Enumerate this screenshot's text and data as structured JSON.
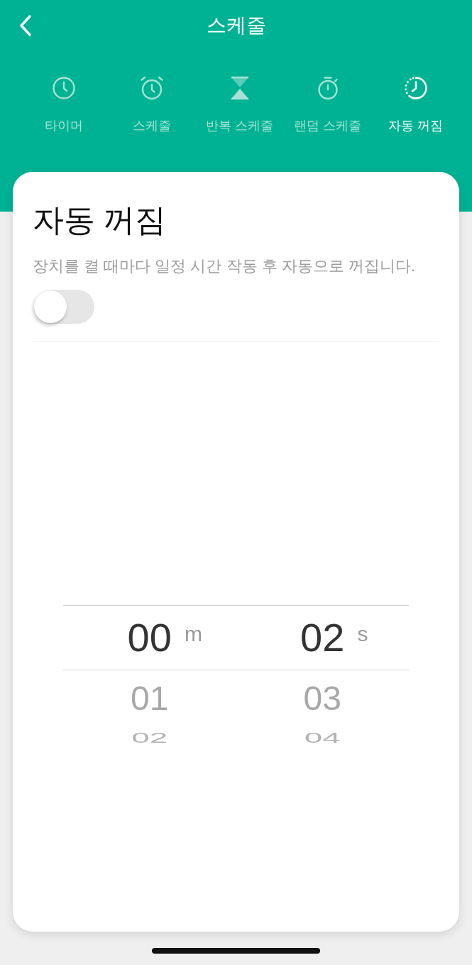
{
  "header": {
    "title": "스케줄"
  },
  "tabs": [
    {
      "kind": "timer",
      "label": "타이머",
      "selected": false
    },
    {
      "kind": "alarm",
      "label": "스케줄",
      "selected": false
    },
    {
      "kind": "repeat",
      "label": "반복 스케줄",
      "selected": false
    },
    {
      "kind": "random",
      "label": "랜덤 스케줄",
      "selected": false
    },
    {
      "kind": "auto_off",
      "label": "자동 꺼짐",
      "selected": true
    }
  ],
  "auto_off": {
    "title": "자동 꺼짐",
    "description": "장치를 켤 때마다 일정 시간 작동 후 자동으로 꺼집니다.",
    "toggle": {
      "on": false
    }
  },
  "picker": {
    "columns": [
      {
        "unit": "m",
        "values": [
          {
            "text": "00",
            "selected": true
          },
          {
            "text": "01",
            "selected": false
          },
          {
            "text": "02",
            "selected": false
          }
        ]
      },
      {
        "unit": "s",
        "values": [
          {
            "text": "02",
            "selected": true
          },
          {
            "text": "03",
            "selected": false
          },
          {
            "text": "04",
            "selected": false
          }
        ]
      }
    ]
  }
}
